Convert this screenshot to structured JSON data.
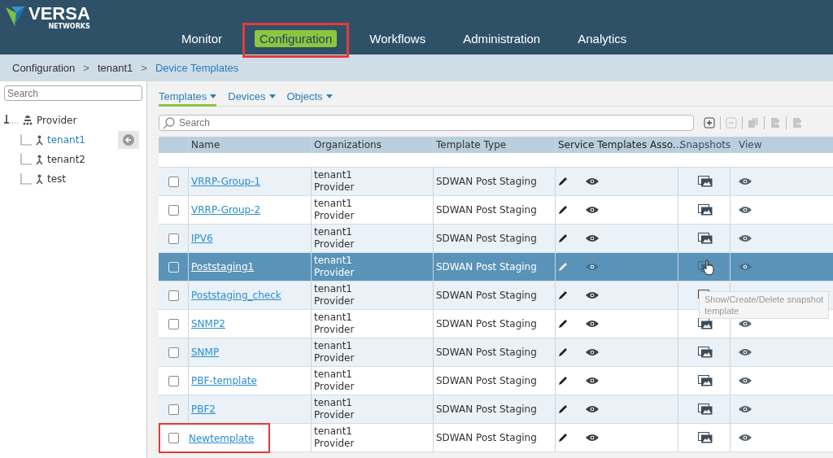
{
  "logo": {
    "name": "VERSA",
    "subtitle": "NETWORKS"
  },
  "nav": [
    {
      "label": "Monitor",
      "selected": false,
      "annotated": false
    },
    {
      "label": "Configuration",
      "selected": true,
      "annotated": true
    },
    {
      "label": "Workflows",
      "selected": false,
      "annotated": false
    },
    {
      "label": "Administration",
      "selected": false,
      "annotated": false
    },
    {
      "label": "Analytics",
      "selected": false,
      "annotated": false
    }
  ],
  "breadcrumb": [
    {
      "label": "Configuration",
      "current": false
    },
    {
      "label": "tenant1",
      "current": false
    },
    {
      "label": "Device Templates",
      "current": true
    }
  ],
  "breadcrumb_separator": ">",
  "sidebar": {
    "search": {
      "placeholder": "Search"
    },
    "tree": [
      {
        "label": "Provider",
        "selected": false,
        "children": [
          {
            "label": "tenant1",
            "selected": true
          },
          {
            "label": "tenant2",
            "selected": false
          },
          {
            "label": "test",
            "selected": false
          }
        ]
      }
    ]
  },
  "tabs": [
    {
      "label": "Templates",
      "selected": true
    },
    {
      "label": "Devices",
      "selected": false
    },
    {
      "label": "Objects",
      "selected": false
    }
  ],
  "search": {
    "placeholder": "Search"
  },
  "toolbar": [
    {
      "kind": "add",
      "disabled": false
    },
    {
      "kind": "remove",
      "disabled": true
    },
    {
      "kind": "copy",
      "disabled": true
    },
    {
      "kind": "export",
      "disabled": true
    },
    {
      "kind": "import",
      "disabled": true
    }
  ],
  "table": {
    "columns": [
      "Name",
      "Organizations",
      "Template Type",
      "Service Templates Asso...",
      "Snapshots",
      "View"
    ],
    "rows": [
      {
        "name": "VRRP-Group-1",
        "orgs": [
          "tenant1",
          "Provider"
        ],
        "type": "SDWAN Post Staging",
        "selected": false,
        "annotated": false
      },
      {
        "name": "VRRP-Group-2",
        "orgs": [
          "tenant1",
          "Provider"
        ],
        "type": "SDWAN Post Staging",
        "selected": false,
        "annotated": false
      },
      {
        "name": "IPV6",
        "orgs": [
          "tenant1",
          "Provider"
        ],
        "type": "SDWAN Post Staging",
        "selected": false,
        "annotated": false
      },
      {
        "name": "Poststaging1",
        "orgs": [
          "tenant1",
          "Provider"
        ],
        "type": "SDWAN Post Staging",
        "selected": true,
        "annotated": false
      },
      {
        "name": "Poststaging_check",
        "orgs": [
          "tenant1",
          "Provider"
        ],
        "type": "SDWAN Post Staging",
        "selected": false,
        "annotated": false,
        "tooltip": [
          "Show/Create/Delete snapshot",
          "template"
        ]
      },
      {
        "name": "SNMP2",
        "orgs": [
          "tenant1",
          "Provider"
        ],
        "type": "SDWAN Post Staging",
        "selected": false,
        "annotated": false
      },
      {
        "name": "SNMP",
        "orgs": [
          "tenant1",
          "Provider"
        ],
        "type": "SDWAN Post Staging",
        "selected": false,
        "annotated": false
      },
      {
        "name": "PBF-template",
        "orgs": [
          "tenant1",
          "Provider"
        ],
        "type": "SDWAN Post Staging",
        "selected": false,
        "annotated": false
      },
      {
        "name": "PBF2",
        "orgs": [
          "tenant1",
          "Provider"
        ],
        "type": "SDWAN Post Staging",
        "selected": false,
        "annotated": false
      },
      {
        "name": "Newtemplate",
        "orgs": [
          "tenant1",
          "Provider"
        ],
        "type": "SDWAN Post Staging",
        "selected": false,
        "annotated": true
      }
    ]
  }
}
